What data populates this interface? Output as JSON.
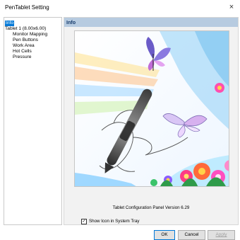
{
  "window": {
    "title": "PenTablet Setting",
    "close_glyph": "×"
  },
  "tree": [
    {
      "label": "Info",
      "selected": true
    },
    {
      "label": "Tablet  1 (8.00x6.00)"
    },
    {
      "label": "Monitor Mapping"
    },
    {
      "label": "Pen Buttons"
    },
    {
      "label": "Work Area"
    },
    {
      "label": "Hot Cells"
    },
    {
      "label": "Pressure"
    }
  ],
  "panel": {
    "title": "Info",
    "version_text": "Tablet Configuration Panel Version 6.29",
    "show_icon": {
      "label": "Show Icon in System Tray",
      "checked": true,
      "glyph": "✓"
    }
  },
  "buttons": {
    "ok": "OK",
    "cancel": "Cancel",
    "apply": "Apply"
  },
  "colors": {
    "accent": "#0078d7",
    "panel_header": "#b7cbe0"
  }
}
